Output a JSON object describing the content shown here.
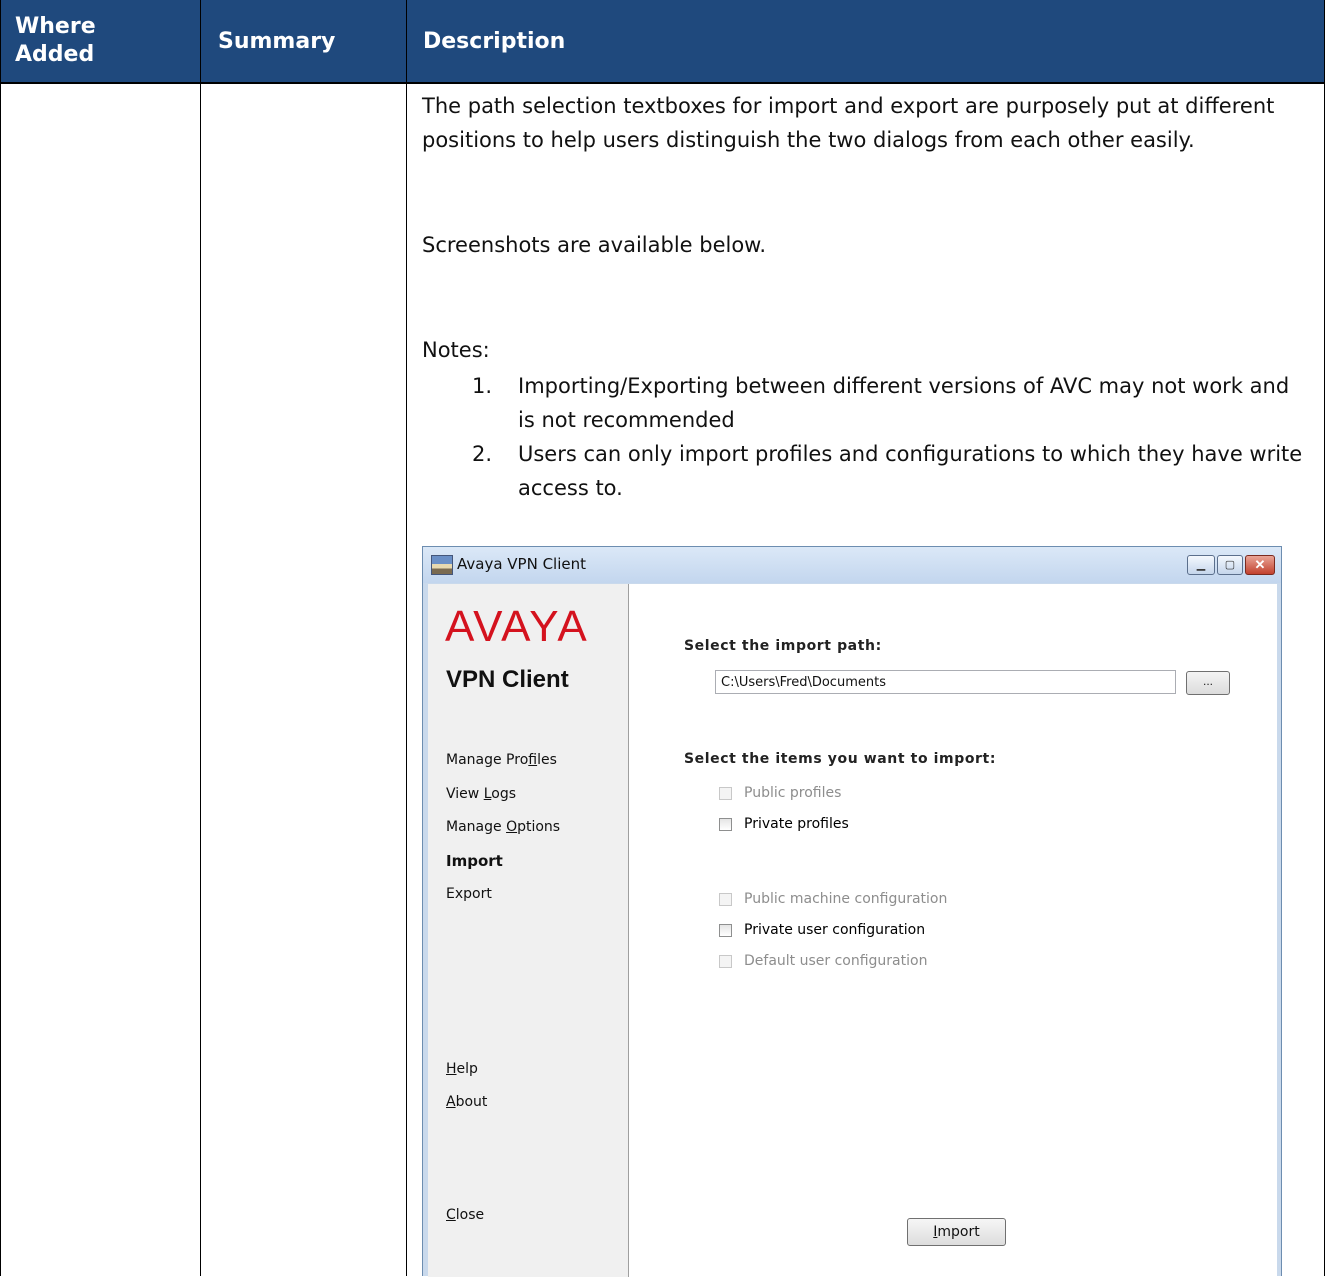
{
  "table": {
    "headers": {
      "where_added": "Where\nAdded",
      "summary": "Summary",
      "description": "Description"
    },
    "description_paragraphs": [
      "The path selection textboxes for import and export are purposely put at different positions to help users distinguish the two dialogs from each other easily.",
      "Screenshots are available below.",
      "Notes:"
    ],
    "notes": [
      {
        "num": "1.",
        "text": "Importing/Exporting between different versions of AVC may not work and is not recommended"
      },
      {
        "num": "2.",
        "text": "Users can only import profiles and configurations to which they have write access to."
      }
    ]
  },
  "window": {
    "title": "Avaya VPN Client",
    "controls": {
      "minimize": "▁",
      "maximize": "▢",
      "close": "✕"
    },
    "sidebar": {
      "logo": "AVAYA",
      "product": "VPN Client",
      "items": [
        {
          "pre": "Manage Pro",
          "u": "f",
          "post": "iles"
        },
        {
          "pre": "View ",
          "u": "L",
          "post": "ogs"
        },
        {
          "pre": "Manage ",
          "u": "O",
          "post": "ptions"
        },
        {
          "pre": "Import",
          "u": "",
          "post": ""
        },
        {
          "pre": "Export",
          "u": "",
          "post": ""
        },
        {
          "pre": "",
          "u": "H",
          "post": "elp"
        },
        {
          "pre": "",
          "u": "A",
          "post": "bout"
        },
        {
          "pre": "",
          "u": "C",
          "post": "lose"
        }
      ]
    },
    "main": {
      "path_label": "Select the import path:",
      "path_value": "C:\\Users\\Fred\\Documents",
      "browse_label": "...",
      "items_label": "Select the items you want to import:",
      "checkboxes": [
        {
          "label": "Public profiles",
          "enabled": false
        },
        {
          "label": "Private profiles",
          "enabled": true
        },
        {
          "label": "Public machine configuration",
          "enabled": false
        },
        {
          "label": "Private user configuration",
          "enabled": true
        },
        {
          "label": "Default user configuration",
          "enabled": false
        }
      ],
      "import_button": {
        "u": "I",
        "post": "mport"
      }
    }
  }
}
